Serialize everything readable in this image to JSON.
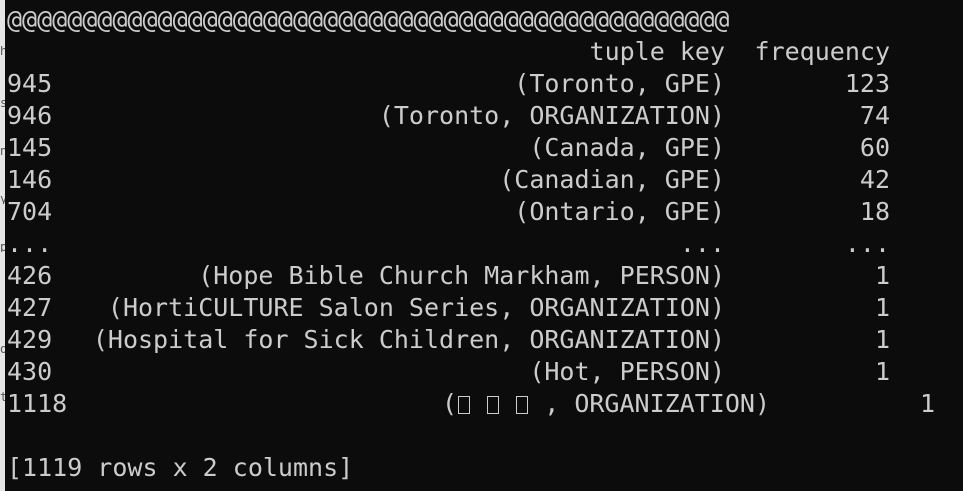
{
  "console": {
    "banner": "@@@@@@@@@@@@@@@@@@@@@@@@@@@@@@@@@@@@@@@@@@@@@@@@",
    "columns": [
      "tuple key",
      "frequency"
    ],
    "rows": [
      {
        "index": "945",
        "key": "(Toronto, GPE)",
        "frequency": "123"
      },
      {
        "index": "946",
        "key": "(Toronto, ORGANIZATION)",
        "frequency": "74"
      },
      {
        "index": "145",
        "key": "(Canada, GPE)",
        "frequency": "60"
      },
      {
        "index": "146",
        "key": "(Canadian, GPE)",
        "frequency": "42"
      },
      {
        "index": "704",
        "key": "(Ontario, GPE)",
        "frequency": "18"
      },
      {
        "index": "...",
        "key": "...",
        "frequency": "..."
      },
      {
        "index": "426",
        "key": "(Hope Bible Church Markham, PERSON)",
        "frequency": "1"
      },
      {
        "index": "427",
        "key": "(HortiCULTURE Salon Series, ORGANIZATION)",
        "frequency": "1"
      },
      {
        "index": "429",
        "key": "(Hospital for Sick Children, ORGANIZATION)",
        "frequency": "1"
      },
      {
        "index": "430",
        "key": "(Hot, PERSON)",
        "frequency": "1"
      }
    ],
    "last_row": {
      "index": "1118",
      "key_open": "(",
      "key_rest": " , ORGANIZATION)",
      "frequency": "1"
    },
    "summary": "[1119 rows x 2 columns]"
  },
  "colors": {
    "background": "#0c0c0c",
    "text": "#cccccc"
  }
}
